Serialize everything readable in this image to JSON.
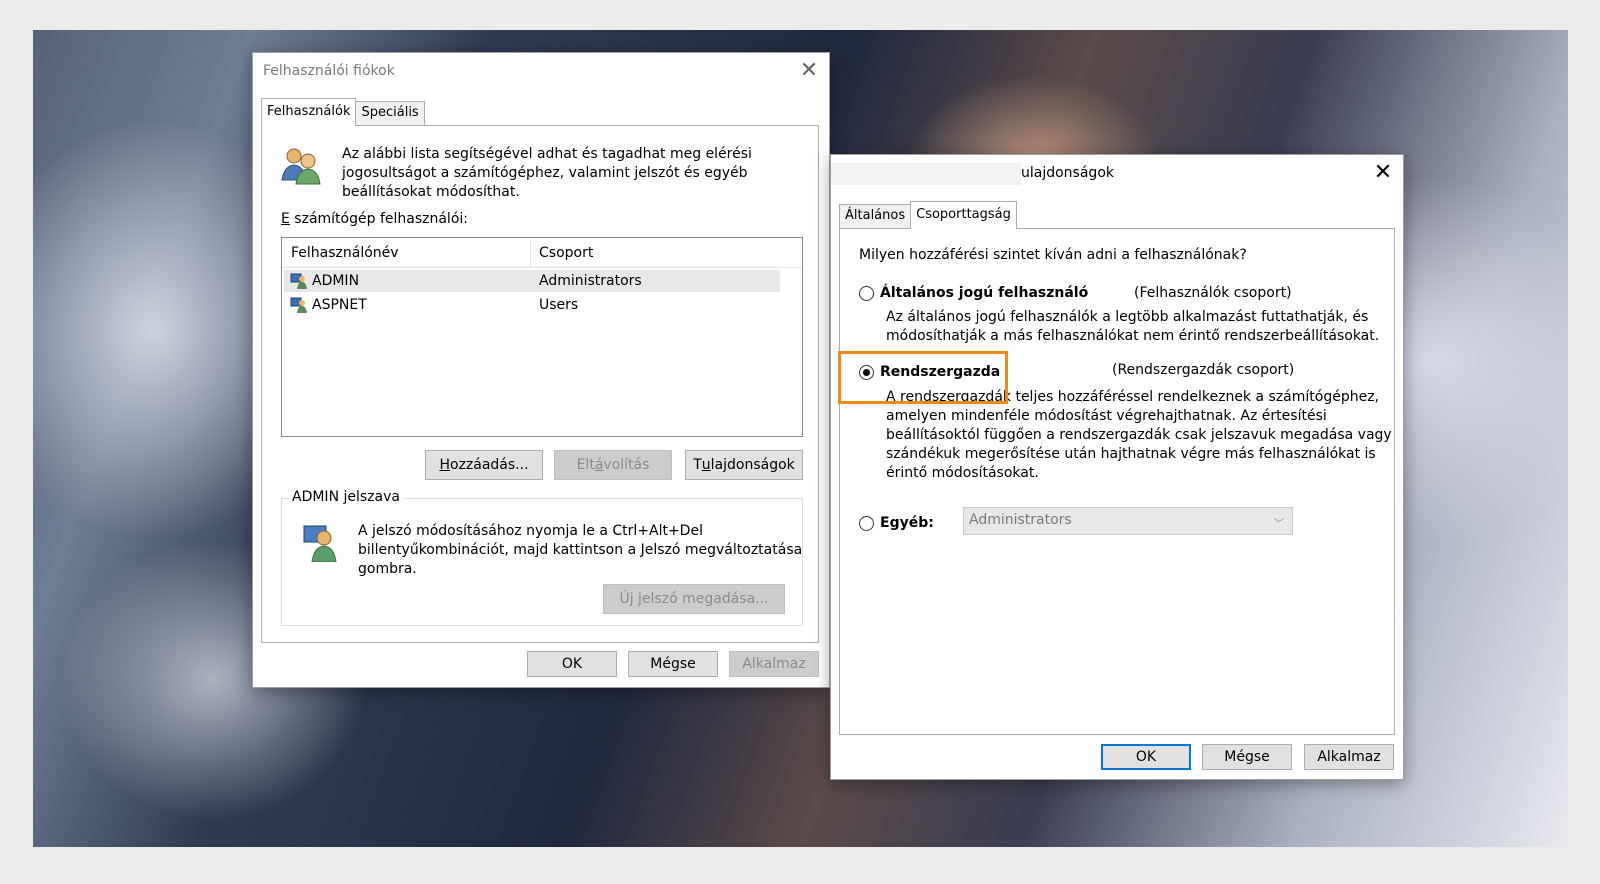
{
  "colors": {
    "highlight": "#f0891c",
    "accent": "#0078d7"
  },
  "user_accounts": {
    "title": "Felhasználói fiókok",
    "tabs": [
      "Felhasználók",
      "Speciális"
    ],
    "intro": [
      "Az alábbi lista segítségével adhat és tagadhat meg elérési",
      "jogosultságot a számítógéphez, valamint jelszót és egyéb",
      "beállításokat módosíthat."
    ],
    "users_label_prefix": "E",
    "users_label_rest": " számítógép felhasználói:",
    "columns": [
      "Felhasználónév",
      "Csoport"
    ],
    "rows": [
      {
        "name": "ADMIN",
        "group": "Administrators"
      },
      {
        "name": "ASPNET",
        "group": "Users"
      }
    ],
    "buttons": {
      "add_pre": "",
      "add_u": "H",
      "add_post": "ozzáadás...",
      "remove_pre": "Elt",
      "remove_u": "á",
      "remove_post": "volítás",
      "props_pre": "T",
      "props_u": "u",
      "props_post": "lajdonságok"
    },
    "password_group_label": "ADMIN jelszava",
    "password_text": [
      "A jelszó módosításához nyomja le a Ctrl+Alt+Del",
      "billentyűkombinációt, majd kattintson a Jelszó megváltoztatása",
      "gombra."
    ],
    "new_password_button": "Új jelszó megadása...",
    "ok": "OK",
    "cancel": "Mégse",
    "apply": "Alkalmaz"
  },
  "properties": {
    "title": "ulajdonságok",
    "tabs": [
      "Általános",
      "Csoporttagság"
    ],
    "question": "Milyen hozzáférési szintet kíván adni a felhasználónak?",
    "options": [
      {
        "label": "Általános jogú felhasználó",
        "group": "(Felhasználók csoport)",
        "desc": [
          "Az általános jogú felhasználók a legtöbb alkalmazást futtathatják, és",
          "módosíthatják a más felhasználókat nem érintő rendszerbeállításokat."
        ],
        "checked": false
      },
      {
        "label": "Rendszergazda",
        "group": "(Rendszergazdák csoport)",
        "desc": [
          "A rendszergazdák teljes hozzáféréssel rendelkeznek a számítógéphez,",
          "amelyen mindenféle módosítást végrehajthatnak. Az értesítési",
          "beállításoktól függően a rendszergazdák csak jelszavuk megadása vagy",
          "szándékuk megerősítése után hajthatnak végre más felhasználókat is",
          "érintő módosításokat."
        ],
        "checked": true
      },
      {
        "label": "Egyéb:",
        "select_value": "Administrators",
        "checked": false
      }
    ],
    "ok": "OK",
    "cancel": "Mégse",
    "apply": "Alkalmaz"
  }
}
